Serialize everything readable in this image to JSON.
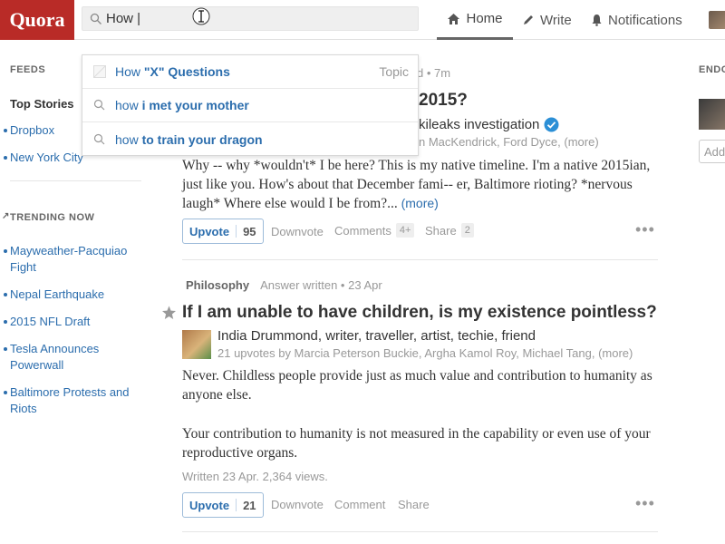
{
  "header": {
    "logo": "Quora",
    "search_value": "How |",
    "nav": {
      "home": "Home",
      "write": "Write",
      "notifications": "Notifications"
    }
  },
  "dropdown": {
    "items": [
      {
        "prefix": "How ",
        "bold": "\"X\" Questions",
        "tag": "Topic"
      },
      {
        "prefix": "how ",
        "bold": "i met your mother"
      },
      {
        "prefix": "how ",
        "bold": "to train your dragon"
      }
    ]
  },
  "sidebar": {
    "feeds_head": "FEEDS",
    "top_stories": "Top Stories",
    "feeds": [
      "Dropbox",
      "New York City"
    ],
    "trending_head": "TRENDING NOW",
    "trending": [
      "Mayweather-Pacquiao Fight",
      "Nepal Earthquake",
      "2015 NFL Draft",
      "Tesla Announces Powerwall",
      "Baltimore Protests and Riots"
    ]
  },
  "feed": {
    "story1": {
      "meta_partial": "d • 7m",
      "title_partial": "2015?",
      "author_partial": "kileaks investigation",
      "upvoters_partial": "n MacKendrick, Ford Dyce, (more)",
      "text": "Why -- why *wouldn't* I be here? This is my native timeline. I'm a native 2015ian, just like you. How's about that December fami-- er, Baltimore rioting? *nervous laugh* Where else would I be from?...",
      "more": "(more)",
      "upvote": "Upvote",
      "upvote_count": "95",
      "downvote": "Downvote",
      "comments": "Comments",
      "comments_count": "4+",
      "share": "Share",
      "share_count": "2"
    },
    "story2": {
      "topic": "Philosophy",
      "meta": "Answer written • 23 Apr",
      "title": "If I am unable to have children, is my existence pointless?",
      "author": "India Drummond, writer, traveller, artist, techie, friend",
      "upvoters": "21 upvotes by Marcia Peterson Buckie, Argha Kamol Roy, Michael Tang, (more)",
      "para1": "Never. Childless people provide just as much value and contribution to humanity as anyone else.",
      "para2": "Your contribution to humanity is not measured in the capability or even use of your reproductive organs.",
      "written": "Written 23 Apr. 2,364 views.",
      "upvote": "Upvote",
      "upvote_count": "21",
      "downvote": "Downvote",
      "comment": "Comment",
      "share": "Share"
    }
  },
  "right": {
    "head": "ENDO",
    "add": "Add"
  },
  "colors": {
    "brand": "#b92b27",
    "link": "#2b6dad"
  }
}
